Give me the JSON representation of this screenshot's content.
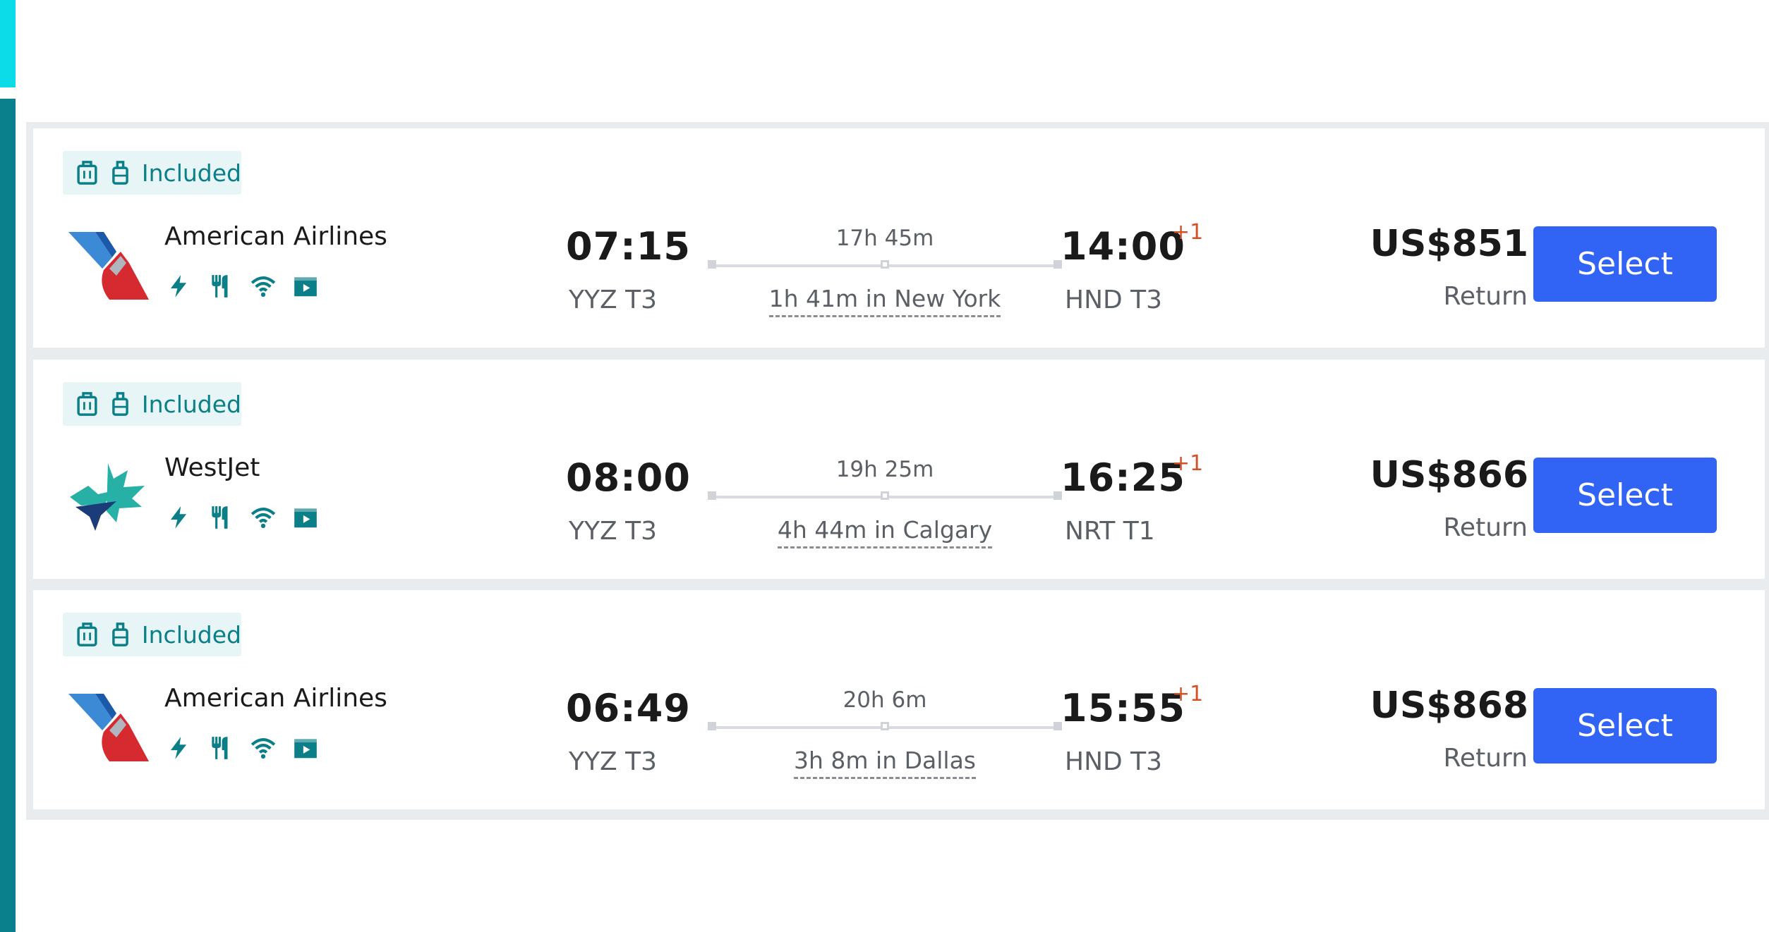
{
  "colors": {
    "accent_cyan": "#0bdce8",
    "accent_teal": "#0a808c",
    "select_blue": "#3163f4",
    "plus_day": "#d3522a"
  },
  "flights": [
    {
      "baggage_label": "Included",
      "airline": "American Airlines",
      "logo": "american-airlines-logo",
      "amenities": [
        "power-icon",
        "meal-icon",
        "wifi-icon",
        "entertainment-icon"
      ],
      "dep_time": "07:15",
      "dep_code": "YYZ T3",
      "duration": "17h 45m",
      "stop": "1h 41m in New York",
      "arr_time": "14:00",
      "day_offset": "+1",
      "arr_code": "HND T3",
      "price": "US$851",
      "price_type": "Return",
      "button": "Select"
    },
    {
      "baggage_label": "Included",
      "airline": "WestJet",
      "logo": "westjet-logo",
      "amenities": [
        "power-icon",
        "meal-icon",
        "wifi-icon",
        "entertainment-icon"
      ],
      "dep_time": "08:00",
      "dep_code": "YYZ T3",
      "duration": "19h 25m",
      "stop": "4h 44m in Calgary",
      "arr_time": "16:25",
      "day_offset": "+1",
      "arr_code": "NRT T1",
      "price": "US$866",
      "price_type": "Return",
      "button": "Select"
    },
    {
      "baggage_label": "Included",
      "airline": "American Airlines",
      "logo": "american-airlines-logo",
      "amenities": [
        "power-icon",
        "meal-icon",
        "wifi-icon",
        "entertainment-icon"
      ],
      "dep_time": "06:49",
      "dep_code": "YYZ T3",
      "duration": "20h 6m",
      "stop": "3h 8m in Dallas",
      "arr_time": "15:55",
      "day_offset": "+1",
      "arr_code": "HND T3",
      "price": "US$868",
      "price_type": "Return",
      "button": "Select"
    }
  ]
}
